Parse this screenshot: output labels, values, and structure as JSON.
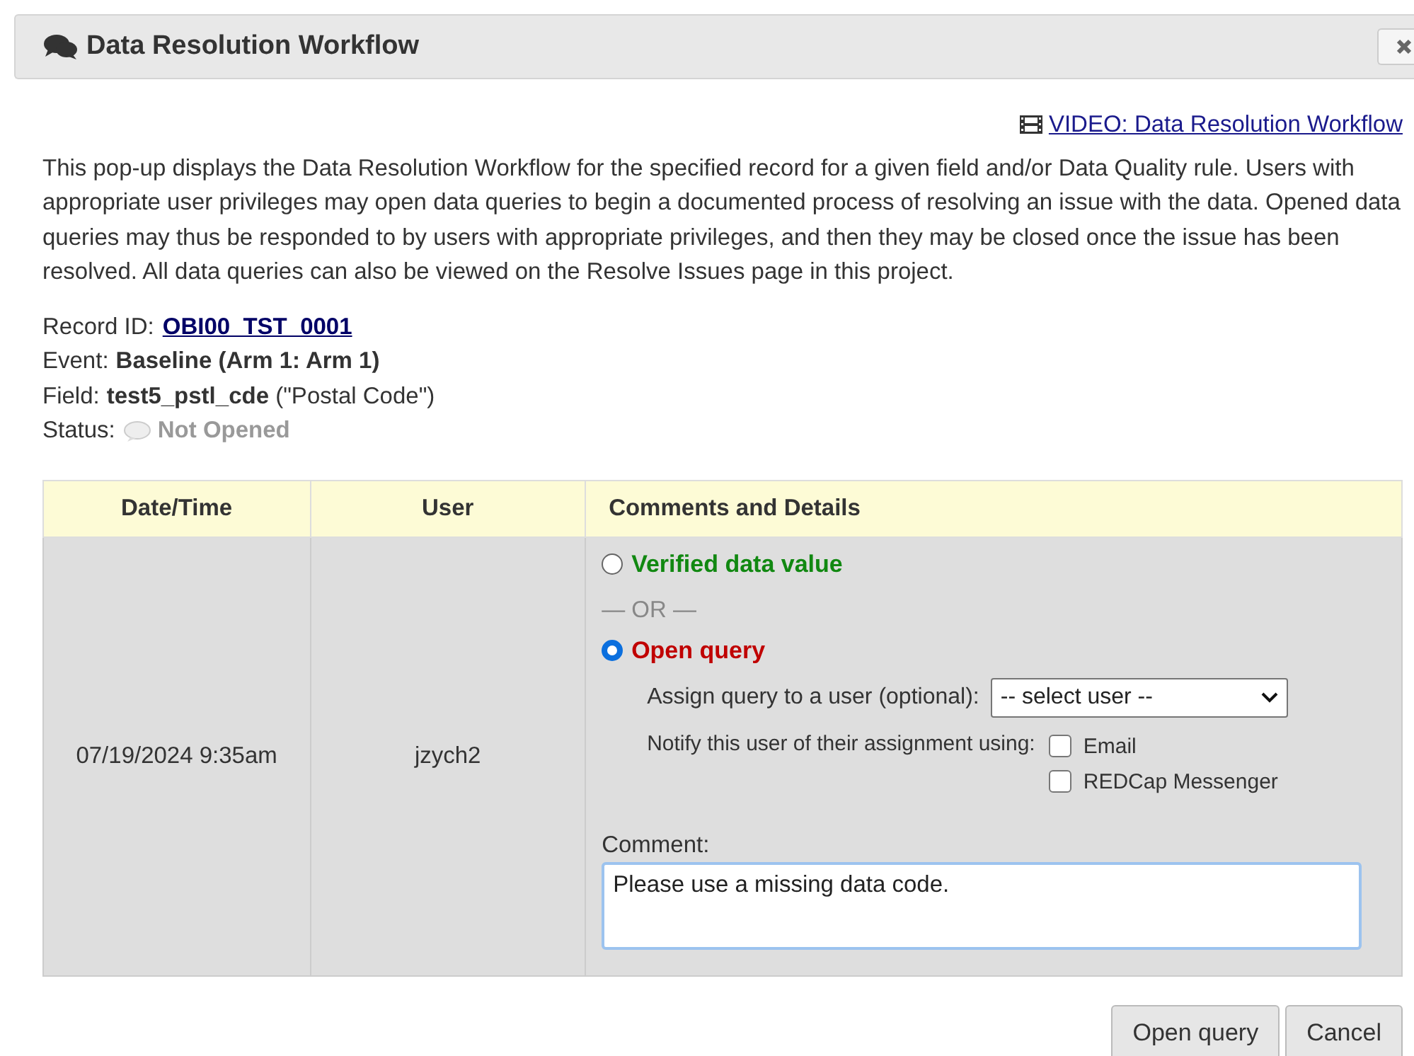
{
  "dialog": {
    "title": "Data Resolution Workflow"
  },
  "video_link": "VIDEO: Data Resolution Workflow",
  "description": "This pop-up displays the Data Resolution Workflow for the specified record for a given field and/or Data Quality rule. Users with appropriate user privileges may open data queries to begin a documented process of resolving an issue with the data. Opened data queries may thus be responded to by users with appropriate privileges, and then they may be closed once the issue has been resolved. All data queries can also be viewed on the Resolve Issues page in this project.",
  "details": [
    {
      "kind": "link",
      "label": "Record ID:",
      "value": "OBI00_TST_0001"
    },
    {
      "kind": "text",
      "label": "Event:",
      "value": "**Baseline (Arm 1: Arm 1)**"
    },
    {
      "kind": "text",
      "label": "Field:",
      "value": "**test5_pstl_cde** (\"Postal Code\")"
    },
    {
      "kind": "status",
      "label": "Status:",
      "value": "Not Opened"
    }
  ],
  "table": {
    "columns": [
      "Date/Time",
      "User",
      "Comments and Details"
    ],
    "row": {
      "date": "07/19/2024 9:35am",
      "user": "jzych2",
      "choices": [
        {
          "label": "Verified data value",
          "selected": false,
          "color": "#118811"
        },
        {
          "label": "Open query",
          "selected": true,
          "color": "#c00000"
        }
      ],
      "separator": "— OR —",
      "assign_label": "Assign query to a user (optional):",
      "assign_value": "-- select user --",
      "notify_label": "Notify this user of their assignment using:",
      "notify_options": [
        {
          "label": "Email",
          "checked": false
        },
        {
          "label": "REDCap Messenger",
          "checked": false
        }
      ],
      "comment_label": "Comment:",
      "comment": "Please use a missing data code."
    }
  },
  "buttons": [
    "Open query",
    "Cancel"
  ]
}
